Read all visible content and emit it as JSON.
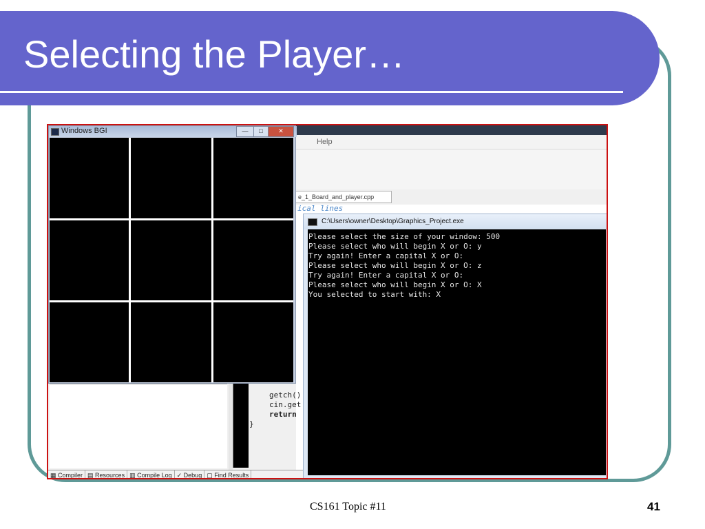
{
  "slide": {
    "title": "Selecting the Player…",
    "footer": "CS161 Topic #11",
    "page_number": "41",
    "accent_color": "#6464cc",
    "frame_color": "#5f9a98"
  },
  "bgi_window": {
    "title": "Windows BGI",
    "controls": [
      "—",
      "□",
      "✕"
    ],
    "grid": {
      "rows": 3,
      "cols": 3
    }
  },
  "ide": {
    "menu_item": "Help",
    "file_tab": "e_1_Board_and_player.cpp",
    "code_lines": [
      {
        "text": "ical lines",
        "style": "comment"
      },
      {
        "text": "getch()",
        "style": "normal"
      },
      {
        "text": "cin.get",
        "style": "normal"
      },
      {
        "text": "return",
        "style": "bold"
      },
      {
        "text": "}",
        "style": "normal"
      }
    ],
    "bottom_tabs": [
      "Compiler",
      "Resources",
      "Compile Log",
      "Debug",
      "Find Results"
    ]
  },
  "console": {
    "title": "C:\\Users\\owner\\Desktop\\Graphics_Project.exe",
    "lines": [
      "Please select the size of your window: 500",
      "Please select who will begin X or O: y",
      "Try again! Enter a capital X or O:",
      "Please select who will begin X or O: z",
      "Try again! Enter a capital X or O:",
      "Please select who will begin X or O: X",
      "You selected to start with: X"
    ]
  }
}
